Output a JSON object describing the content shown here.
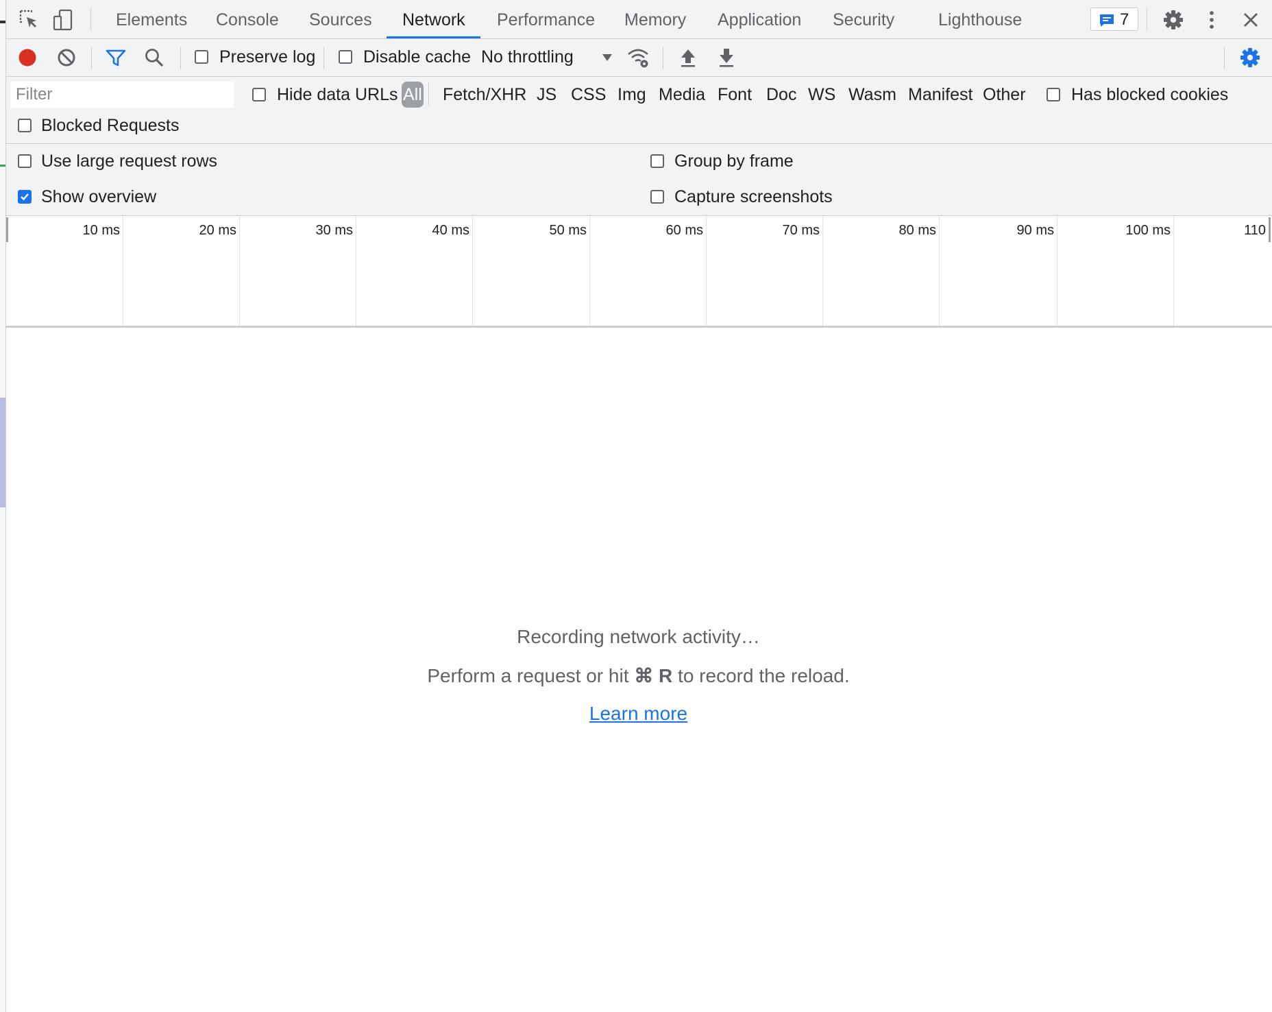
{
  "tabbar": {
    "tabs": [
      {
        "label": "Elements",
        "active": false
      },
      {
        "label": "Console",
        "active": false
      },
      {
        "label": "Sources",
        "active": false
      },
      {
        "label": "Network",
        "active": true
      },
      {
        "label": "Performance",
        "active": false
      },
      {
        "label": "Memory",
        "active": false
      },
      {
        "label": "Application",
        "active": false
      },
      {
        "label": "Security",
        "active": false
      },
      {
        "label": "Lighthouse",
        "active": false
      }
    ],
    "issues_count": "7",
    "icons": [
      "inspect-element-icon",
      "device-toolbar-icon",
      "issues-icon",
      "settings-gear-icon",
      "more-options-icon",
      "close-icon"
    ]
  },
  "toolbar": {
    "preserve_log": {
      "label": "Preserve log",
      "checked": false
    },
    "disable_cache": {
      "label": "Disable cache",
      "checked": false
    },
    "throttling": "No throttling",
    "icons": [
      "record-icon",
      "clear-icon",
      "filter-icon",
      "search-icon",
      "network-conditions-icon",
      "import-har-icon",
      "export-har-icon",
      "network-settings-gear-icon"
    ]
  },
  "filter": {
    "placeholder": "Filter",
    "value": "",
    "hide_data_urls": {
      "label": "Hide data URLs",
      "checked": false
    },
    "types": [
      "All",
      "Fetch/XHR",
      "JS",
      "CSS",
      "Img",
      "Media",
      "Font",
      "Doc",
      "WS",
      "Wasm",
      "Manifest",
      "Other"
    ],
    "selected_type": "All",
    "has_blocked_cookies": {
      "label": "Has blocked cookies",
      "checked": false
    },
    "blocked_requests": {
      "label": "Blocked Requests",
      "checked": false
    }
  },
  "settings": {
    "use_large_rows": {
      "label": "Use large request rows",
      "checked": false
    },
    "group_by_frame": {
      "label": "Group by frame",
      "checked": false
    },
    "show_overview": {
      "label": "Show overview",
      "checked": true
    },
    "capture_screenshots": {
      "label": "Capture screenshots",
      "checked": false
    }
  },
  "overview": {
    "ticks": [
      "10 ms",
      "20 ms",
      "30 ms",
      "40 ms",
      "50 ms",
      "60 ms",
      "70 ms",
      "80 ms",
      "90 ms",
      "100 ms",
      "110"
    ]
  },
  "empty_state": {
    "title": "Recording network activity…",
    "hint_before": "Perform a request or hit ",
    "hint_shortcut": "⌘ R",
    "hint_after": " to record the reload.",
    "link": "Learn more"
  },
  "colors": {
    "accent": "#1a73e8",
    "record": "#d93025",
    "toolbar_bg": "#f1f3f4",
    "border": "#cacdd1"
  }
}
